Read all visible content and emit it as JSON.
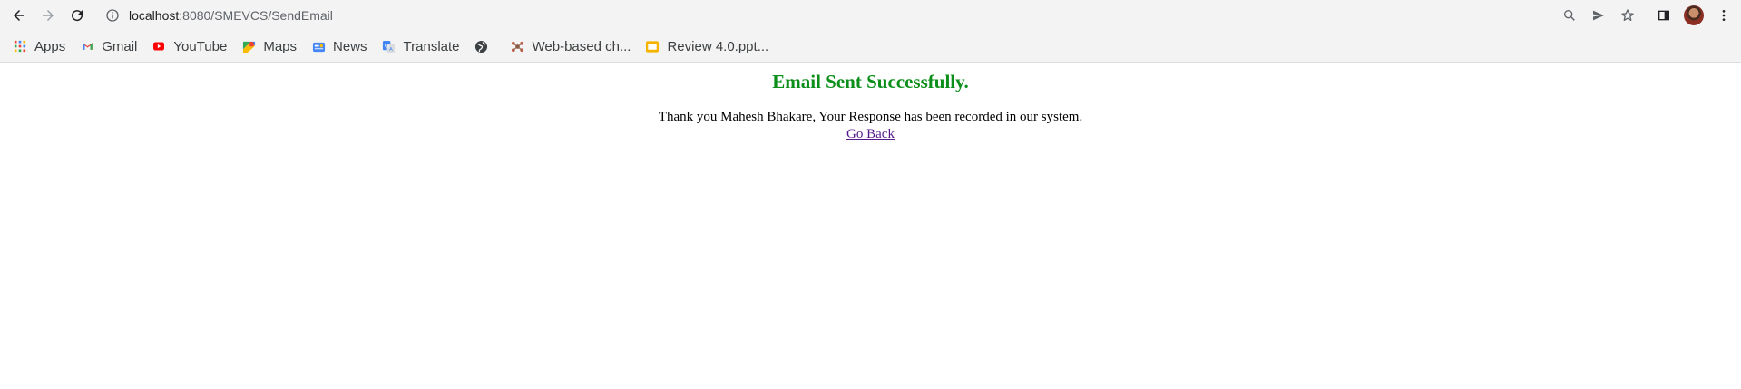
{
  "browser": {
    "url_host": "localhost",
    "url_path": ":8080/SMEVCS/SendEmail",
    "icons": {
      "back": "arrow-left-icon",
      "forward": "arrow-right-icon",
      "reload": "reload-icon",
      "site_info": "info-icon",
      "zoom": "zoom-icon",
      "send": "send-icon",
      "bookmark": "star-icon",
      "side_panel": "side-panel-icon",
      "menu": "kebab-menu-icon"
    }
  },
  "bookmarks": [
    {
      "label": "Apps",
      "icon": "apps-grid-icon"
    },
    {
      "label": "Gmail",
      "icon": "gmail-icon"
    },
    {
      "label": "YouTube",
      "icon": "youtube-icon"
    },
    {
      "label": "Maps",
      "icon": "maps-icon"
    },
    {
      "label": "News",
      "icon": "news-icon"
    },
    {
      "label": "Translate",
      "icon": "translate-icon"
    },
    {
      "label": "",
      "icon": "globe-icon"
    },
    {
      "label": "Web-based ch...",
      "icon": "web-app-icon"
    },
    {
      "label": "Review 4.0.ppt...",
      "icon": "slides-icon"
    }
  ],
  "page": {
    "heading": "Email Sent Successfully.",
    "message": "Thank you Mahesh Bhakare, Your Response has been recorded in our system.",
    "back_link": "Go Back",
    "colors": {
      "heading": "#0b8f1a",
      "link": "#551a8b"
    }
  }
}
